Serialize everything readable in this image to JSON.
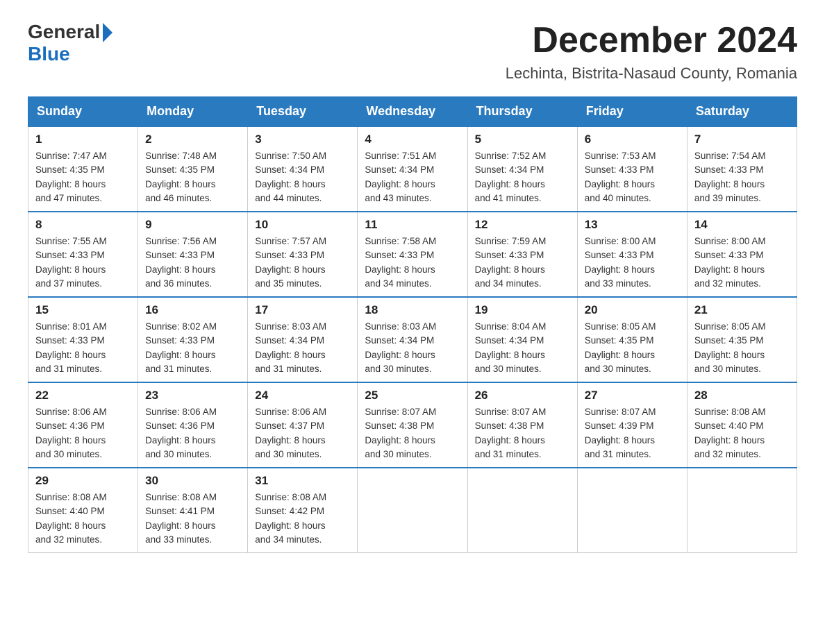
{
  "header": {
    "title": "December 2024",
    "subtitle": "Lechinta, Bistrita-Nasaud County, Romania"
  },
  "logo": {
    "general": "General",
    "blue": "Blue"
  },
  "days_of_week": [
    "Sunday",
    "Monday",
    "Tuesday",
    "Wednesday",
    "Thursday",
    "Friday",
    "Saturday"
  ],
  "weeks": [
    [
      {
        "day": "1",
        "sunrise": "Sunrise: 7:47 AM",
        "sunset": "Sunset: 4:35 PM",
        "daylight": "Daylight: 8 hours",
        "daylight2": "and 47 minutes."
      },
      {
        "day": "2",
        "sunrise": "Sunrise: 7:48 AM",
        "sunset": "Sunset: 4:35 PM",
        "daylight": "Daylight: 8 hours",
        "daylight2": "and 46 minutes."
      },
      {
        "day": "3",
        "sunrise": "Sunrise: 7:50 AM",
        "sunset": "Sunset: 4:34 PM",
        "daylight": "Daylight: 8 hours",
        "daylight2": "and 44 minutes."
      },
      {
        "day": "4",
        "sunrise": "Sunrise: 7:51 AM",
        "sunset": "Sunset: 4:34 PM",
        "daylight": "Daylight: 8 hours",
        "daylight2": "and 43 minutes."
      },
      {
        "day": "5",
        "sunrise": "Sunrise: 7:52 AM",
        "sunset": "Sunset: 4:34 PM",
        "daylight": "Daylight: 8 hours",
        "daylight2": "and 41 minutes."
      },
      {
        "day": "6",
        "sunrise": "Sunrise: 7:53 AM",
        "sunset": "Sunset: 4:33 PM",
        "daylight": "Daylight: 8 hours",
        "daylight2": "and 40 minutes."
      },
      {
        "day": "7",
        "sunrise": "Sunrise: 7:54 AM",
        "sunset": "Sunset: 4:33 PM",
        "daylight": "Daylight: 8 hours",
        "daylight2": "and 39 minutes."
      }
    ],
    [
      {
        "day": "8",
        "sunrise": "Sunrise: 7:55 AM",
        "sunset": "Sunset: 4:33 PM",
        "daylight": "Daylight: 8 hours",
        "daylight2": "and 37 minutes."
      },
      {
        "day": "9",
        "sunrise": "Sunrise: 7:56 AM",
        "sunset": "Sunset: 4:33 PM",
        "daylight": "Daylight: 8 hours",
        "daylight2": "and 36 minutes."
      },
      {
        "day": "10",
        "sunrise": "Sunrise: 7:57 AM",
        "sunset": "Sunset: 4:33 PM",
        "daylight": "Daylight: 8 hours",
        "daylight2": "and 35 minutes."
      },
      {
        "day": "11",
        "sunrise": "Sunrise: 7:58 AM",
        "sunset": "Sunset: 4:33 PM",
        "daylight": "Daylight: 8 hours",
        "daylight2": "and 34 minutes."
      },
      {
        "day": "12",
        "sunrise": "Sunrise: 7:59 AM",
        "sunset": "Sunset: 4:33 PM",
        "daylight": "Daylight: 8 hours",
        "daylight2": "and 34 minutes."
      },
      {
        "day": "13",
        "sunrise": "Sunrise: 8:00 AM",
        "sunset": "Sunset: 4:33 PM",
        "daylight": "Daylight: 8 hours",
        "daylight2": "and 33 minutes."
      },
      {
        "day": "14",
        "sunrise": "Sunrise: 8:00 AM",
        "sunset": "Sunset: 4:33 PM",
        "daylight": "Daylight: 8 hours",
        "daylight2": "and 32 minutes."
      }
    ],
    [
      {
        "day": "15",
        "sunrise": "Sunrise: 8:01 AM",
        "sunset": "Sunset: 4:33 PM",
        "daylight": "Daylight: 8 hours",
        "daylight2": "and 31 minutes."
      },
      {
        "day": "16",
        "sunrise": "Sunrise: 8:02 AM",
        "sunset": "Sunset: 4:33 PM",
        "daylight": "Daylight: 8 hours",
        "daylight2": "and 31 minutes."
      },
      {
        "day": "17",
        "sunrise": "Sunrise: 8:03 AM",
        "sunset": "Sunset: 4:34 PM",
        "daylight": "Daylight: 8 hours",
        "daylight2": "and 31 minutes."
      },
      {
        "day": "18",
        "sunrise": "Sunrise: 8:03 AM",
        "sunset": "Sunset: 4:34 PM",
        "daylight": "Daylight: 8 hours",
        "daylight2": "and 30 minutes."
      },
      {
        "day": "19",
        "sunrise": "Sunrise: 8:04 AM",
        "sunset": "Sunset: 4:34 PM",
        "daylight": "Daylight: 8 hours",
        "daylight2": "and 30 minutes."
      },
      {
        "day": "20",
        "sunrise": "Sunrise: 8:05 AM",
        "sunset": "Sunset: 4:35 PM",
        "daylight": "Daylight: 8 hours",
        "daylight2": "and 30 minutes."
      },
      {
        "day": "21",
        "sunrise": "Sunrise: 8:05 AM",
        "sunset": "Sunset: 4:35 PM",
        "daylight": "Daylight: 8 hours",
        "daylight2": "and 30 minutes."
      }
    ],
    [
      {
        "day": "22",
        "sunrise": "Sunrise: 8:06 AM",
        "sunset": "Sunset: 4:36 PM",
        "daylight": "Daylight: 8 hours",
        "daylight2": "and 30 minutes."
      },
      {
        "day": "23",
        "sunrise": "Sunrise: 8:06 AM",
        "sunset": "Sunset: 4:36 PM",
        "daylight": "Daylight: 8 hours",
        "daylight2": "and 30 minutes."
      },
      {
        "day": "24",
        "sunrise": "Sunrise: 8:06 AM",
        "sunset": "Sunset: 4:37 PM",
        "daylight": "Daylight: 8 hours",
        "daylight2": "and 30 minutes."
      },
      {
        "day": "25",
        "sunrise": "Sunrise: 8:07 AM",
        "sunset": "Sunset: 4:38 PM",
        "daylight": "Daylight: 8 hours",
        "daylight2": "and 30 minutes."
      },
      {
        "day": "26",
        "sunrise": "Sunrise: 8:07 AM",
        "sunset": "Sunset: 4:38 PM",
        "daylight": "Daylight: 8 hours",
        "daylight2": "and 31 minutes."
      },
      {
        "day": "27",
        "sunrise": "Sunrise: 8:07 AM",
        "sunset": "Sunset: 4:39 PM",
        "daylight": "Daylight: 8 hours",
        "daylight2": "and 31 minutes."
      },
      {
        "day": "28",
        "sunrise": "Sunrise: 8:08 AM",
        "sunset": "Sunset: 4:40 PM",
        "daylight": "Daylight: 8 hours",
        "daylight2": "and 32 minutes."
      }
    ],
    [
      {
        "day": "29",
        "sunrise": "Sunrise: 8:08 AM",
        "sunset": "Sunset: 4:40 PM",
        "daylight": "Daylight: 8 hours",
        "daylight2": "and 32 minutes."
      },
      {
        "day": "30",
        "sunrise": "Sunrise: 8:08 AM",
        "sunset": "Sunset: 4:41 PM",
        "daylight": "Daylight: 8 hours",
        "daylight2": "and 33 minutes."
      },
      {
        "day": "31",
        "sunrise": "Sunrise: 8:08 AM",
        "sunset": "Sunset: 4:42 PM",
        "daylight": "Daylight: 8 hours",
        "daylight2": "and 34 minutes."
      },
      null,
      null,
      null,
      null
    ]
  ]
}
